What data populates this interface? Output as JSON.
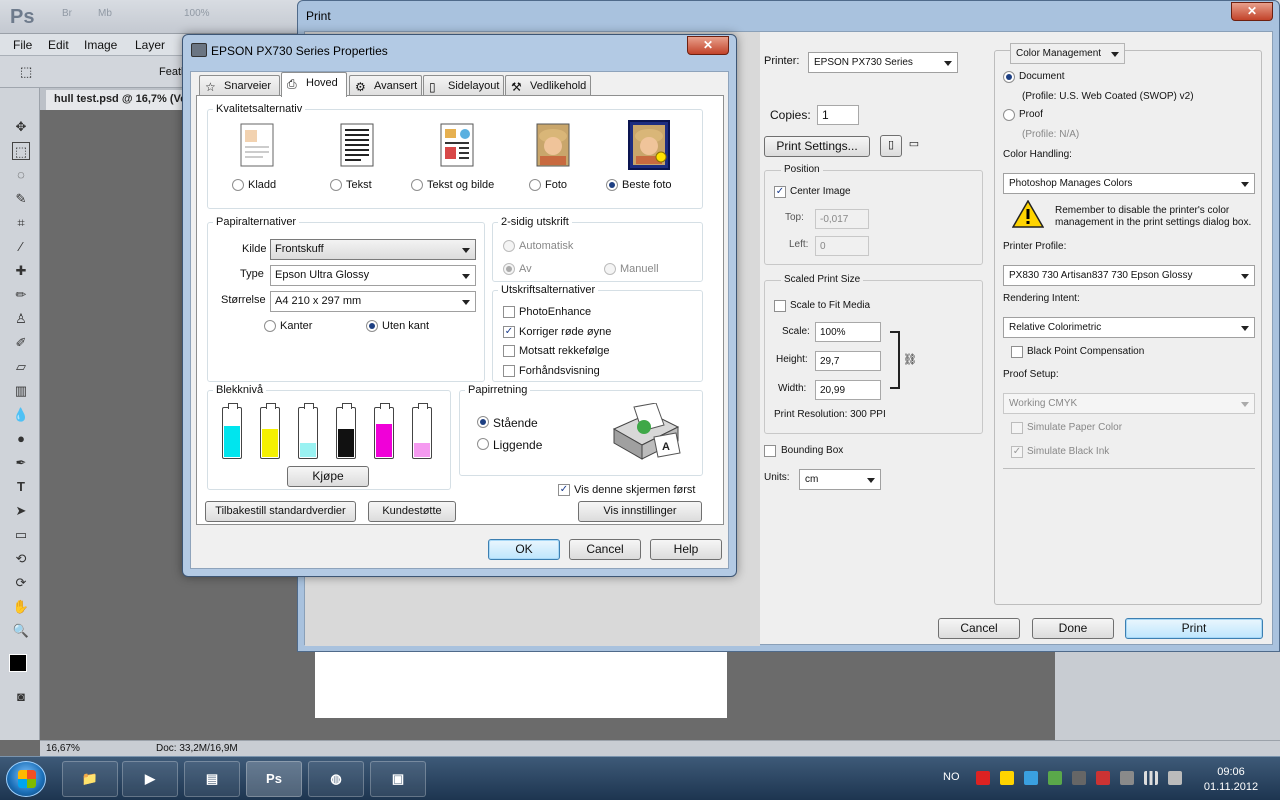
{
  "photoshop": {
    "logo": "Ps",
    "top_buttons": [
      "Br",
      "Mb",
      "100%"
    ],
    "menu": [
      "File",
      "Edit",
      "Image",
      "Layer"
    ],
    "option_label": "Feath",
    "document_tab": "hull test.psd @ 16,7% (Ve",
    "status_zoom": "16,67%",
    "status_doc": "Doc: 33,2M/16,9M"
  },
  "print_dialog": {
    "title": "Print",
    "close_symbol": "✕",
    "printer_label": "Printer:",
    "printer_value": "EPSON PX730 Series",
    "copies_label": "Copies:",
    "copies_value": "1",
    "print_settings_button": "Print Settings...",
    "position": {
      "title": "Position",
      "center_image": "Center Image",
      "top_label": "Top:",
      "top_value": "-0,017",
      "left_label": "Left:",
      "left_value": "0"
    },
    "scaled": {
      "title": "Scaled Print Size",
      "scale_to_fit": "Scale to Fit Media",
      "scale_label": "Scale:",
      "scale_value": "100%",
      "height_label": "Height:",
      "height_value": "29,7",
      "width_label": "Width:",
      "width_value": "20,99",
      "resolution": "Print Resolution: 300 PPI"
    },
    "bounding_box": "Bounding Box",
    "units_label": "Units:",
    "units_value": "cm",
    "color_management": {
      "menu": "Color Management",
      "document": "Document",
      "document_profile": "(Profile: U.S. Web Coated (SWOP) v2)",
      "proof": "Proof",
      "proof_profile": "(Profile: N/A)",
      "color_handling_label": "Color Handling:",
      "color_handling_value": "Photoshop Manages Colors",
      "warning": "Remember to disable the printer's color management in the print settings dialog box.",
      "printer_profile_label": "Printer Profile:",
      "printer_profile_value": "PX830 730 Artisan837 730 Epson Glossy",
      "rendering_intent_label": "Rendering Intent:",
      "rendering_intent_value": "Relative Colorimetric",
      "black_point": "Black Point Compensation",
      "proof_setup_label": "Proof Setup:",
      "proof_setup_value": "Working CMYK",
      "simulate_paper": "Simulate Paper Color",
      "simulate_black": "Simulate Black Ink"
    },
    "cancel": "Cancel",
    "done": "Done",
    "print": "Print"
  },
  "epson": {
    "title": "EPSON PX730 Series Properties",
    "close_symbol": "✕",
    "tabs": [
      "Snarveier",
      "Hoved",
      "Avansert",
      "Sidelayout",
      "Vedlikehold"
    ],
    "quality": {
      "title": "Kvalitetsalternativ",
      "options": [
        "Kladd",
        "Tekst",
        "Tekst og bilde",
        "Foto",
        "Beste foto"
      ],
      "selected": "Beste foto"
    },
    "paper": {
      "title": "Papiralternativer",
      "source_label": "Kilde",
      "source_value": "Frontskuff",
      "type_label": "Type",
      "type_value": "Epson Ultra Glossy",
      "size_label": "Størrelse",
      "size_value": "A4 210 x 297 mm",
      "border": "Kanter",
      "borderless": "Uten kant"
    },
    "duplex": {
      "title": "2-sidig utskrift",
      "auto": "Automatisk",
      "off": "Av",
      "manual": "Manuell"
    },
    "print_options": {
      "title": "Utskriftsalternativer",
      "photo_enhance": "PhotoEnhance",
      "red_eye": "Korriger røde øyne",
      "reverse": "Motsatt rekkefølge",
      "preview": "Forhåndsvisning"
    },
    "ink": {
      "title": "Blekknivå",
      "levels": [
        {
          "color": "#00e5ee",
          "level": 0.62
        },
        {
          "color": "#f5f000",
          "level": 0.55
        },
        {
          "color": "#9af2f2",
          "level": 0.28
        },
        {
          "color": "#111111",
          "level": 0.55
        },
        {
          "color": "#f000d8",
          "level": 0.65
        },
        {
          "color": "#f59af0",
          "level": 0.28
        }
      ],
      "buy_button": "Kjøpe"
    },
    "orientation": {
      "title": "Papirretning",
      "portrait": "Stående",
      "landscape": "Liggende"
    },
    "show_first": "Vis denne skjermen først",
    "reset_button": "Tilbakestill standardverdier",
    "support_button": "Kundestøtte",
    "show_settings_button": "Vis innstillinger",
    "ok": "OK",
    "cancel": "Cancel",
    "help": "Help"
  },
  "taskbar": {
    "language": "NO",
    "time": "09:06",
    "date": "01.11.2012"
  }
}
